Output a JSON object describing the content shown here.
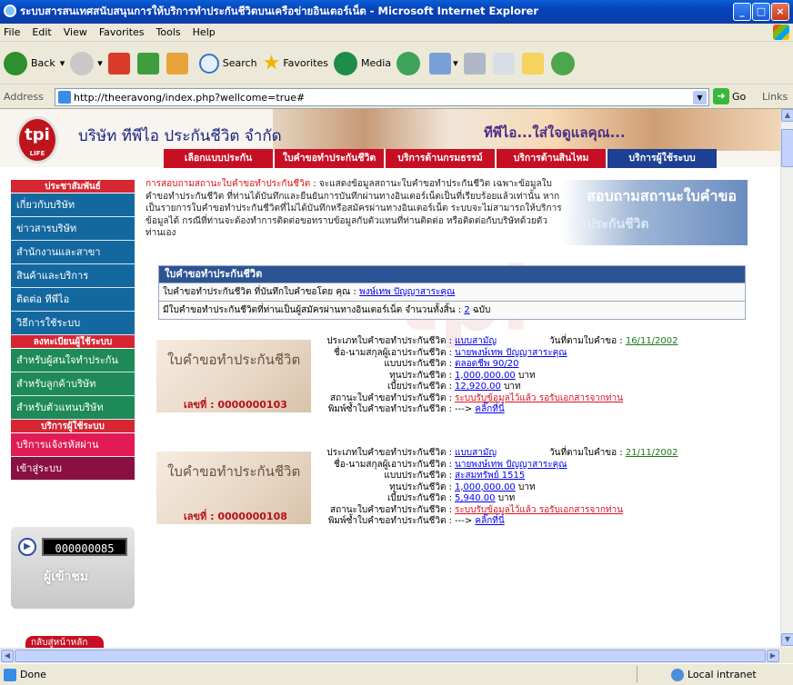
{
  "window": {
    "title": "ระบบสารสนเทศสนับสนุนการให้บริการทำประกันชีวิตบนเครือข่ายอินเตอร์เน็ต - Microsoft Internet Explorer",
    "min": "_",
    "max": "□",
    "close": "×"
  },
  "menu": [
    "File",
    "Edit",
    "View",
    "Favorites",
    "Tools",
    "Help"
  ],
  "toolbar": {
    "back": "Back",
    "search": "Search",
    "favorites": "Favorites",
    "media": "Media"
  },
  "address": {
    "label": "Address",
    "url": "http://theeravong/index.php?wellcome=true#",
    "go": "Go",
    "links": "Links"
  },
  "status": {
    "text": "Done",
    "zone": "Local intranet"
  },
  "page": {
    "company": "บริษัท ทีพีไอ ประกันชีวิต จำกัด",
    "logo": "tpi",
    "logo_sub": "LIFE",
    "slogan": "ทีพีไอ...ใส่ใจดูแลคุณ...",
    "nav": [
      "เลือกแบบประกัน",
      "ใบคำขอทำประกันชีวิต",
      "บริการด้านกรมธรรม์",
      "บริการด้านสินไหม",
      "บริการผู้ใช้ระบบ"
    ],
    "sidebar": {
      "h1": "ประชาสัมพันธ์",
      "g1": [
        "เกี่ยวกับบริษัท",
        "ข่าวสารบริษัท",
        "สำนักงานและสาขา",
        "สินค้าและบริการ",
        "ติดต่อ ทีพีไอ",
        "วิธีการใช้ระบบ"
      ],
      "h2": "ลงทะเบียนผู้ใช้ระบบ",
      "g2": [
        "สำหรับผู้สนใจทำประกัน",
        "สำหรับลูกค้าบริษัท",
        "สำหรับตัวแทนบริษัท"
      ],
      "h3": "บริการผู้ใช้ระบบ",
      "g3": [
        "บริการแจ้งรหัสผ่าน",
        "เข้าสู่ระบบ"
      ]
    },
    "counter": {
      "value": "000000085",
      "label": "ผู้เข้าชม"
    },
    "home_button": "กลับสู่หน้าหลัก",
    "intro": {
      "lead": "การสอบถามสถานะใบคำขอทำประกันชีวิต",
      "body": " : จะแสดงข้อมูลสถานะใบคำขอทำประกันชีวิต เฉพาะข้อมูลใบคำขอทำประกันชีวิต ที่ท่านได้บันทึกและยืนยันการบันทึกผ่านทางอินเตอร์เน็ตเป็นที่เรียบร้อยแล้วเท่านั้น หากเป็นรายการใบคำขอทำประกันชีวิตที่ไม่ได้บันทึกหรือสมัครผ่านทางอินเตอร์เน็ต ระบบจะไม่สามารถให้บริการข้อมูลได้ กรณีที่ท่านจะต้องทำการติดต่อขอทราบข้อมูลกับตัวแทนที่ท่านติดต่อ หรือติดต่อกับบริษัทด้วยตัวท่านเอง",
      "img_text": "สอบถามสถานะใบคำขอ",
      "img_text2": "ทำประกันชีวิต"
    },
    "summary": {
      "header": "ใบคำขอทำประกันชีวิต",
      "row1_label": "ใบคำขอทำประกันชีวิต ที่บันทึกใบคำขอโดย คุณ : ",
      "row1_name": "พงษ์เทพ ปัญญาสาระคุณ",
      "row2_label": "มีใบคำขอทำประกันชีวิตที่ท่านเป็นผู้สมัครผ่านทางอินเตอร์เน็ต จำนวนทั้งสิ้น : ",
      "row2_count": "2",
      "row2_unit": " ฉบับ"
    },
    "field_labels": [
      "ประเภทใบคำขอทำประกันชีวิต :",
      "ชื่อ-นามสกุลผู้เอาประกันชีวิต :",
      "แบบประกันชีวิต :",
      "ทุนประกันชีวิต :",
      "เบี้ยประกันชีวิต :",
      "สถานะใบคำขอทำประกันชีวิต :",
      "พิมพ์ซ้ำใบคำขอทำประกันชีวิต :"
    ],
    "image_title": "ใบคำขอทำประกันชีวิต",
    "no_label": "เลขที่ : ",
    "date_label": "วันที่ตามใบคำขอ : ",
    "applications": [
      {
        "no": "0000000103",
        "type": "แบบสามัญ",
        "name": "นายพงษ์เทพ ปัญญาสาระคุณ",
        "plan": "ตลอดชีพ 90/20",
        "sum": "1,000,000.00",
        "premium": "12,920.00",
        "unit": " บาท",
        "status": "ระบบรับข้อมูลไว้แล้ว รอรับเอกสารจากท่าน",
        "print_prefix": "---> ",
        "print": "คลิ๊กที่นี่",
        "date": "16/11/2002"
      },
      {
        "no": "0000000108",
        "type": "แบบสามัญ",
        "name": "นายพงษ์เทพ ปัญญาสาระคุณ",
        "plan": "สะสมทรัพย์ 1515",
        "sum": "1,000,000.00",
        "premium": "5,940.00",
        "unit": " บาท",
        "status": "ระบบรับข้อมูลไว้แล้ว รอรับเอกสารจากท่าน",
        "print_prefix": "---> ",
        "print": "คลิ๊กที่นี่",
        "date": "21/11/2002"
      }
    ]
  }
}
